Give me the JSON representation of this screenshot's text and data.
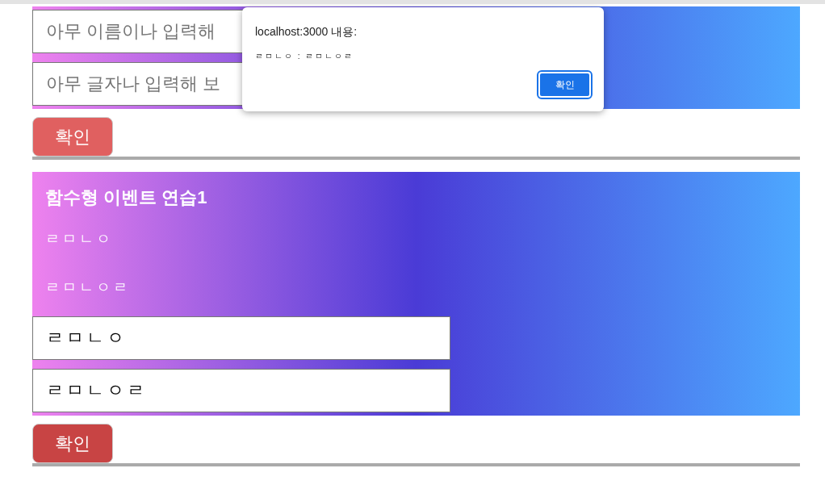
{
  "dialog": {
    "title": "localhost:3000 내용:",
    "message": "ㄹㅁㄴㅇ : ㄹㅁㄴㅇㄹ",
    "button": "확인"
  },
  "sections": [
    {
      "inputs": [
        {
          "placeholder": "아무 이름이나 입력해"
        },
        {
          "placeholder": "아무 글자나 입력해 보"
        }
      ],
      "button": {
        "label": "확인",
        "color": "#e06060"
      }
    },
    {
      "title": "함수형 이벤트 연습1",
      "lines": [
        "ㄹㅁㄴㅇ",
        "ㄹㅁㄴㅇㄹ"
      ],
      "inputs": [
        {
          "value": "ㄹㅁㄴㅇ"
        },
        {
          "value": "ㄹㅁㄴㅇㄹ"
        }
      ],
      "button": {
        "label": "확인",
        "color": "#c84444"
      }
    }
  ]
}
